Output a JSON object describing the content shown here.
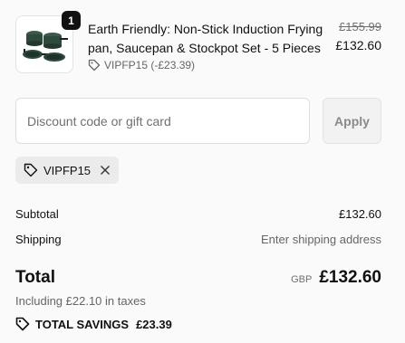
{
  "product": {
    "quantity_badge": "1",
    "title": "Earth Friendly: Non-Stick Induction Frying pan, Saucepan & Stockpot Set - 5 Pieces",
    "discount_tag": "VIPFP15 (-£23.39)",
    "original_price": "£155.99",
    "price": "£132.60",
    "thumbnail_icon": "cookware-set-image"
  },
  "discount": {
    "placeholder": "Discount code or gift card",
    "value": "",
    "apply_label": "Apply"
  },
  "applied_code": {
    "code": "VIPFP15",
    "tag_icon": "tag-icon",
    "remove_icon": "close-icon"
  },
  "summary": {
    "subtotal_label": "Subtotal",
    "subtotal_value": "£132.60",
    "shipping_label": "Shipping",
    "shipping_value": "Enter shipping address",
    "total_label": "Total",
    "currency": "GBP",
    "total_value": "£132.60",
    "taxes_note": "Including £22.10 in taxes",
    "savings_label": "TOTAL SAVINGS",
    "savings_value": "£23.39"
  },
  "colors": {
    "background": "#fafafa",
    "text": "#111111",
    "muted": "#666666",
    "chip": "#ebebeb",
    "badge": "#111111",
    "cookware": "#2f4a3c"
  }
}
